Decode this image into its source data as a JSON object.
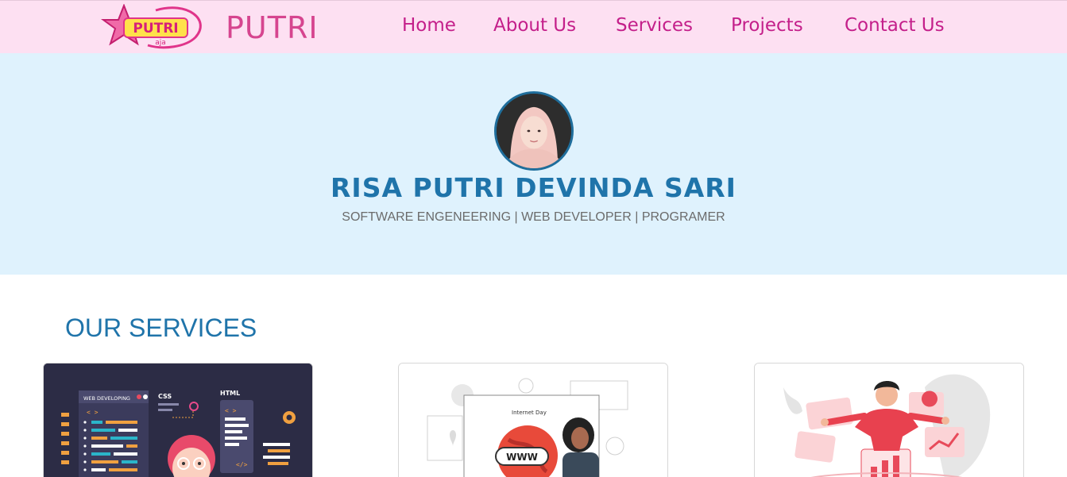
{
  "navbar": {
    "logo_text": "PUTRI",
    "logo_subtext": "aja",
    "brand": "PUTRI",
    "links": [
      {
        "label": "Home"
      },
      {
        "label": "About Us"
      },
      {
        "label": "Services"
      },
      {
        "label": "Projects"
      },
      {
        "label": "Contact Us"
      }
    ]
  },
  "hero": {
    "name": "RISA PUTRI DEVINDA SARI",
    "subtitle": "SOFTWARE ENGENEERING | WEB DEVELOPER | PROGRAMER"
  },
  "services": {
    "title": "OUR SERVICES",
    "cards": [
      {
        "image_labels": [
          "WEB DEVELOPING",
          "CSS",
          "HTML"
        ]
      },
      {
        "image_labels": [
          "Internet Day",
          "WWW"
        ]
      },
      {
        "image_labels": []
      }
    ]
  },
  "colors": {
    "navbar_bg": "#fde0f2",
    "nav_link": "#c41f8a",
    "hero_bg": "#dff2fd",
    "accent_blue": "#1f74aa"
  }
}
